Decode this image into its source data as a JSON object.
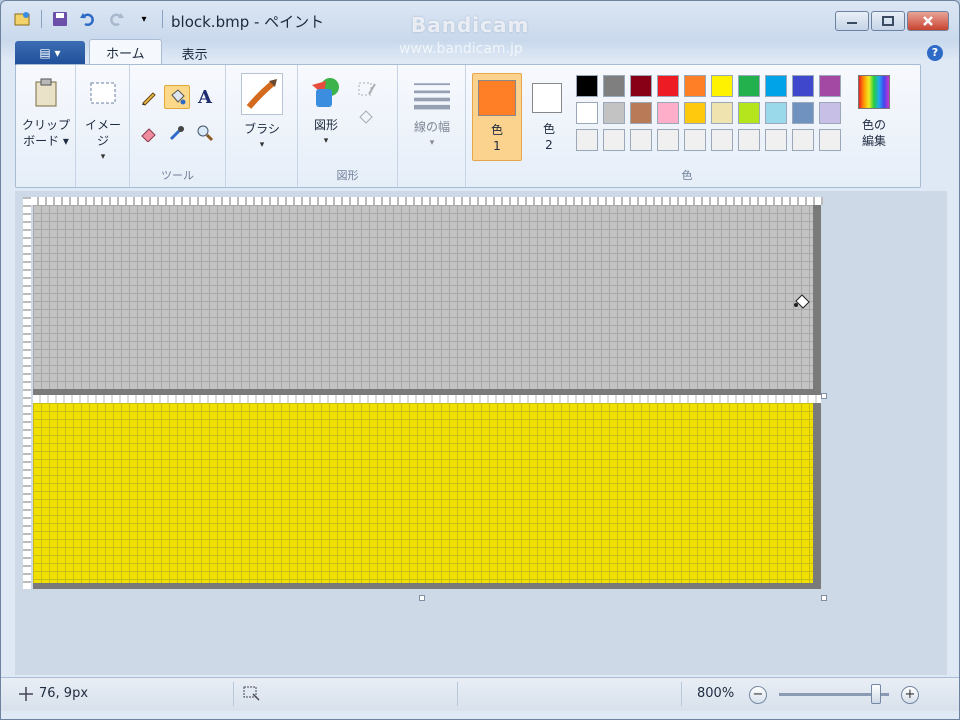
{
  "window": {
    "title": "block.bmp - ペイント"
  },
  "watermark": {
    "brand": "Bandicam",
    "url": "www.bandicam.jp"
  },
  "tabs": {
    "file_label": "▤ ▾",
    "home": "ホーム",
    "view": "表示"
  },
  "ribbon": {
    "clipboard": {
      "line1": "クリップ",
      "line2": "ボード ▾"
    },
    "image": {
      "label": "イメージ",
      "arrow": "▾"
    },
    "tools": {
      "group_label": "ツール"
    },
    "brush": {
      "label": "ブラシ",
      "arrow": "▾"
    },
    "shapes": {
      "label": "図形",
      "arrow": "▾",
      "group_label": "図形"
    },
    "stroke": {
      "label": "線の幅",
      "arrow": "▾"
    },
    "color1": {
      "line1": "色",
      "line2": "1",
      "value": "#ff7f27"
    },
    "color2": {
      "line1": "色",
      "line2": "2",
      "value": "#ffffff"
    },
    "edit_colors": {
      "line1": "色の",
      "line2": "編集"
    },
    "colors_group_label": "色",
    "palette": [
      "#000000",
      "#7f7f7f",
      "#880015",
      "#ed1c24",
      "#ff7f27",
      "#fff200",
      "#22b14c",
      "#00a2e8",
      "#3f48cc",
      "#a349a4",
      "#ffffff",
      "#c3c3c3",
      "#b97a57",
      "#ffaec9",
      "#ffc90e",
      "#efe4b0",
      "#b5e61d",
      "#99d9ea",
      "#7092be",
      "#c8bfe7",
      "#f0f0f0",
      "#f0f0f0",
      "#f0f0f0",
      "#f0f0f0",
      "#f0f0f0",
      "#f0f0f0",
      "#f0f0f0",
      "#f0f0f0",
      "#f0f0f0",
      "#f0f0f0"
    ]
  },
  "canvas": {
    "block1_color": "#c3c3c3",
    "block2_color": "#f0e000"
  },
  "status": {
    "position": "76, 9px",
    "zoom": "800%",
    "zoom_minus": "−",
    "zoom_plus": "+"
  }
}
